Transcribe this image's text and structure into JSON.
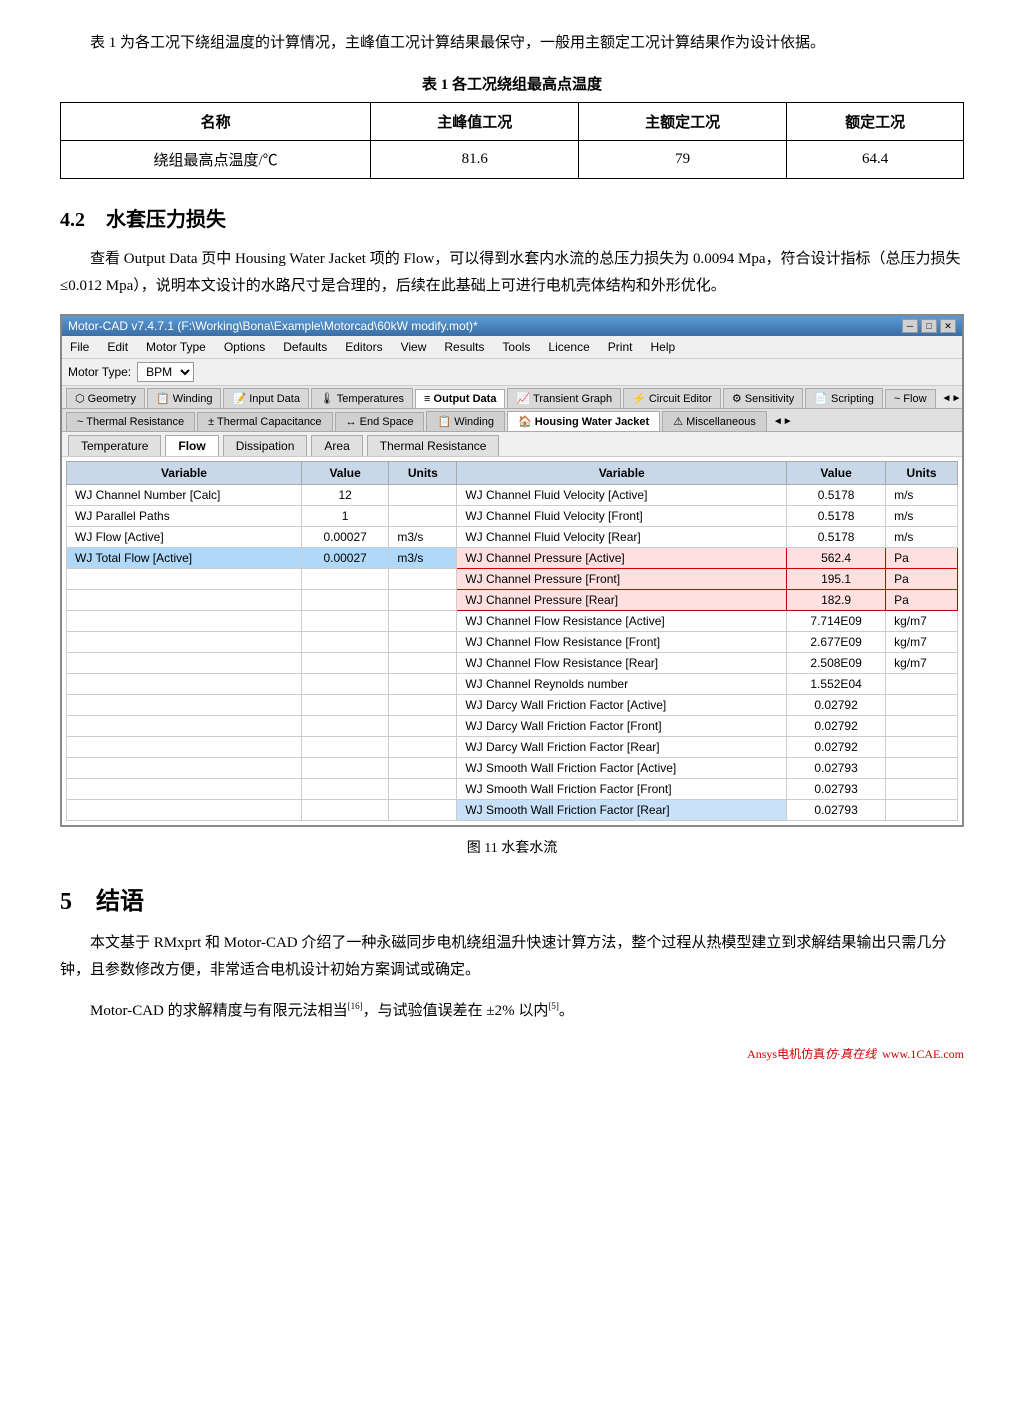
{
  "intro": {
    "text": "表 1 为各工况下绕组温度的计算情况，主峰值工况计算结果最保守，一般用主额定工况计算结果作为设计依据。"
  },
  "table1": {
    "caption": "表 1  各工况绕组最高点温度",
    "headers": [
      "名称",
      "主峰值工况",
      "主额定工况",
      "额定工况"
    ],
    "rows": [
      [
        "绕组最高点温度/℃",
        "81.6",
        "79",
        "64.4"
      ]
    ]
  },
  "section42": {
    "number": "4.2",
    "title": "水套压力损失",
    "body": "查看 Output Data 页中 Housing Water Jacket 项的 Flow，可以得到水套内水流的总压力损失为 0.0094 Mpa，符合设计指标（总压力损失≤0.012 Mpa），说明本文设计的水路尺寸是合理的，后续在此基础上可进行电机壳体结构和外形优化。"
  },
  "motorcad_window": {
    "title": "Motor-CAD v7.4.7.1 (F:\\Working\\Bona\\Example\\Motorcad\\60kW modify.mot)*",
    "menu_items": [
      "File",
      "Edit",
      "Motor Type",
      "Options",
      "Defaults",
      "Editors",
      "View",
      "Results",
      "Tools",
      "Licence",
      "Print",
      "Help"
    ],
    "motor_type_label": "Motor Type:",
    "motor_type_value": "BPM",
    "main_tabs": [
      {
        "label": "Geometry",
        "icon": "⬡",
        "active": false
      },
      {
        "label": "Winding",
        "icon": "📋",
        "active": false
      },
      {
        "label": "Input Data",
        "icon": "📝",
        "active": false
      },
      {
        "label": "Temperatures",
        "icon": "🌡",
        "active": false
      },
      {
        "label": "Output Data",
        "icon": "≡",
        "active": true
      },
      {
        "label": "Transient Graph",
        "icon": "📈",
        "active": false
      },
      {
        "label": "Circuit Editor",
        "icon": "⚡",
        "active": false
      },
      {
        "label": "Sensitivity",
        "icon": "⚙",
        "active": false
      },
      {
        "label": "Scripting",
        "icon": "📄",
        "active": false
      },
      {
        "label": "Flow",
        "icon": "~",
        "active": false
      }
    ],
    "sub_tabs": [
      {
        "label": "Thermal Resistance",
        "icon": "~",
        "active": false
      },
      {
        "label": "Thermal Capacitance",
        "icon": "±",
        "active": false
      },
      {
        "label": "End Space",
        "icon": "↔",
        "active": false
      },
      {
        "label": "Winding",
        "icon": "📋",
        "active": false
      },
      {
        "label": "Housing Water Jacket",
        "icon": "🏠",
        "active": true
      },
      {
        "label": "Miscellaneous",
        "icon": "⚠",
        "active": false
      }
    ],
    "content_tabs": [
      "Temperature",
      "Flow",
      "Dissipation",
      "Area",
      "Thermal Resistance"
    ],
    "active_content_tab": "Flow",
    "grid": {
      "col_headers": [
        "Variable",
        "Value",
        "Units",
        "Variable",
        "Value",
        "Units"
      ],
      "rows": [
        {
          "left_var": "WJ Channel Number [Calc]",
          "left_val": "12",
          "left_unit": "",
          "right_var": "WJ Channel Fluid Velocity [Active]",
          "right_val": "0.5178",
          "right_unit": "m/s",
          "highlight": false
        },
        {
          "left_var": "WJ Parallel Paths",
          "left_val": "1",
          "left_unit": "",
          "right_var": "WJ Channel Fluid Velocity [Front]",
          "right_val": "0.5178",
          "right_unit": "m/s",
          "highlight": false
        },
        {
          "left_var": "WJ Flow [Active]",
          "left_val": "0.00027",
          "left_unit": "m3/s",
          "right_var": "WJ Channel Fluid Velocity [Rear]",
          "right_val": "0.5178",
          "right_unit": "m/s",
          "highlight": false
        },
        {
          "left_var": "WJ Total Flow [Active]",
          "left_val": "0.00027",
          "left_unit": "m3/s",
          "right_var": "WJ Channel Pressure [Active]",
          "right_val": "562.4",
          "right_unit": "Pa",
          "highlight_left": true,
          "highlight_right": true
        },
        {
          "left_var": "",
          "left_val": "",
          "left_unit": "",
          "right_var": "WJ Channel Pressure [Front]",
          "right_val": "195.1",
          "right_unit": "Pa",
          "highlight_right": true
        },
        {
          "left_var": "",
          "left_val": "",
          "left_unit": "",
          "right_var": "WJ Channel Pressure [Rear]",
          "right_val": "182.9",
          "right_unit": "Pa",
          "highlight_right": true
        },
        {
          "left_var": "",
          "left_val": "",
          "left_unit": "",
          "right_var": "WJ Channel Flow Resistance [Active]",
          "right_val": "7.714E09",
          "right_unit": "kg/m7"
        },
        {
          "left_var": "",
          "left_val": "",
          "left_unit": "",
          "right_var": "WJ Channel Flow Resistance [Front]",
          "right_val": "2.677E09",
          "right_unit": "kg/m7"
        },
        {
          "left_var": "",
          "left_val": "",
          "left_unit": "",
          "right_var": "WJ Channel Flow Resistance [Rear]",
          "right_val": "2.508E09",
          "right_unit": "kg/m7"
        },
        {
          "left_var": "",
          "left_val": "",
          "left_unit": "",
          "right_var": "WJ Channel Reynolds number",
          "right_val": "1.552E04",
          "right_unit": ""
        },
        {
          "left_var": "",
          "left_val": "",
          "left_unit": "",
          "right_var": "WJ Darcy Wall Friction Factor [Active]",
          "right_val": "0.02792",
          "right_unit": ""
        },
        {
          "left_var": "",
          "left_val": "",
          "left_unit": "",
          "right_var": "WJ Darcy Wall Friction Factor [Front]",
          "right_val": "0.02792",
          "right_unit": ""
        },
        {
          "left_var": "",
          "left_val": "",
          "left_unit": "",
          "right_var": "WJ Darcy Wall Friction Factor [Rear]",
          "right_val": "0.02792",
          "right_unit": ""
        },
        {
          "left_var": "",
          "left_val": "",
          "left_unit": "",
          "right_var": "WJ Smooth Wall Friction Factor [Active]",
          "right_val": "0.02793",
          "right_unit": ""
        },
        {
          "left_var": "",
          "left_val": "",
          "left_unit": "",
          "right_var": "WJ Smooth Wall Friction Factor [Front]",
          "right_val": "0.02793",
          "right_unit": ""
        },
        {
          "left_var": "",
          "left_val": "",
          "left_unit": "",
          "right_var": "WJ Smooth Wall Friction Factor [Rear]",
          "right_val": "0.02793",
          "right_unit": ""
        }
      ]
    }
  },
  "figure_caption": "图 11  水套水流",
  "section5": {
    "number": "5",
    "title": "结语",
    "body1": "本文基于 RMxprt 和 Motor-CAD 介绍了一种永磁同步电机绕组温升快速计算方法，整个过程从热模型建立到求解结果输出只需几分钟，且参数修改方便，非常适合电机设计初始方案调试或确定。",
    "body2": "Motor-CAD 的求解精度与有限元法相当[16]，与试验值误差在 ±2% 以内[5]。"
  },
  "watermark": "Ansys电机仿真·真在线  www.1CAE.com"
}
